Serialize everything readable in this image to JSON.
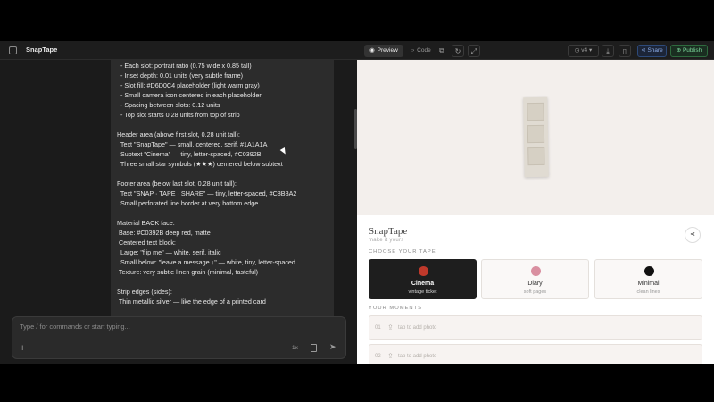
{
  "app": {
    "title": "SnapTape"
  },
  "toolbar": {
    "tabs": [
      {
        "label": "Preview",
        "icon": "eye-icon"
      },
      {
        "label": "Code",
        "icon": "code-icon"
      }
    ],
    "version": "v4",
    "share_label": "Share",
    "publish_label": "Publish"
  },
  "chat": {
    "message_lines": [
      "  - Each slot: portrait ratio (0.75 wide x 0.85 tall)",
      "  - Inset depth: 0.01 units (very subtle frame)",
      "  - Slot fill: #D6D0C4 placeholder (light warm gray)",
      "  - Small camera icon centered in each placeholder",
      "  - Spacing between slots: 0.12 units",
      "  - Top slot starts 0.28 units from top of strip",
      "",
      "Header area (above first slot, 0.28 unit tall):",
      "  Text \"SnapTape\" — small, centered, serif, #1A1A1A",
      "  Subtext \"Cinema\" — tiny, letter-spaced, #C0392B",
      "  Three small star symbols (★★★) centered below subtext",
      "",
      "Footer area (below last slot, 0.28 unit tall):",
      "  Text \"SNAP · TAPE · SHARE\" — tiny, letter-spaced, #C8B8A2",
      "  Small perforated line border at very bottom edge",
      "",
      "Material BACK face:",
      " Base: #C0392B deep red, matte",
      " Centered text block:",
      "  Large: \"flip me\" — white, serif, italic",
      "  Small below: \"leave a message ↓\" — white, tiny, letter-spaced",
      " Texture: very subtle linen grain (minimal, tasteful)",
      "",
      "Strip edges (sides):",
      " Thin metallic silver — like the edge of a printed card"
    ],
    "input_placeholder": "Type / for commands or start typing...",
    "speed": "1x"
  },
  "preview": {
    "brand": "SnapTape",
    "tagline": "make it yours",
    "choose_label": "CHOOSE YOUR TAPE",
    "tapes": [
      {
        "name": "Cinema",
        "sub": "vintage ticket",
        "color": "#C0392B",
        "selected": true
      },
      {
        "name": "Diary",
        "sub": "soft pages",
        "color": "#D98FA0",
        "selected": false
      },
      {
        "name": "Minimal",
        "sub": "clean lines",
        "color": "#111111",
        "selected": false
      }
    ],
    "moments_label": "YOUR MOMENTS",
    "moments": [
      {
        "num": "01",
        "text": "tap to add photo"
      },
      {
        "num": "02",
        "text": "tap to add photo"
      }
    ]
  }
}
